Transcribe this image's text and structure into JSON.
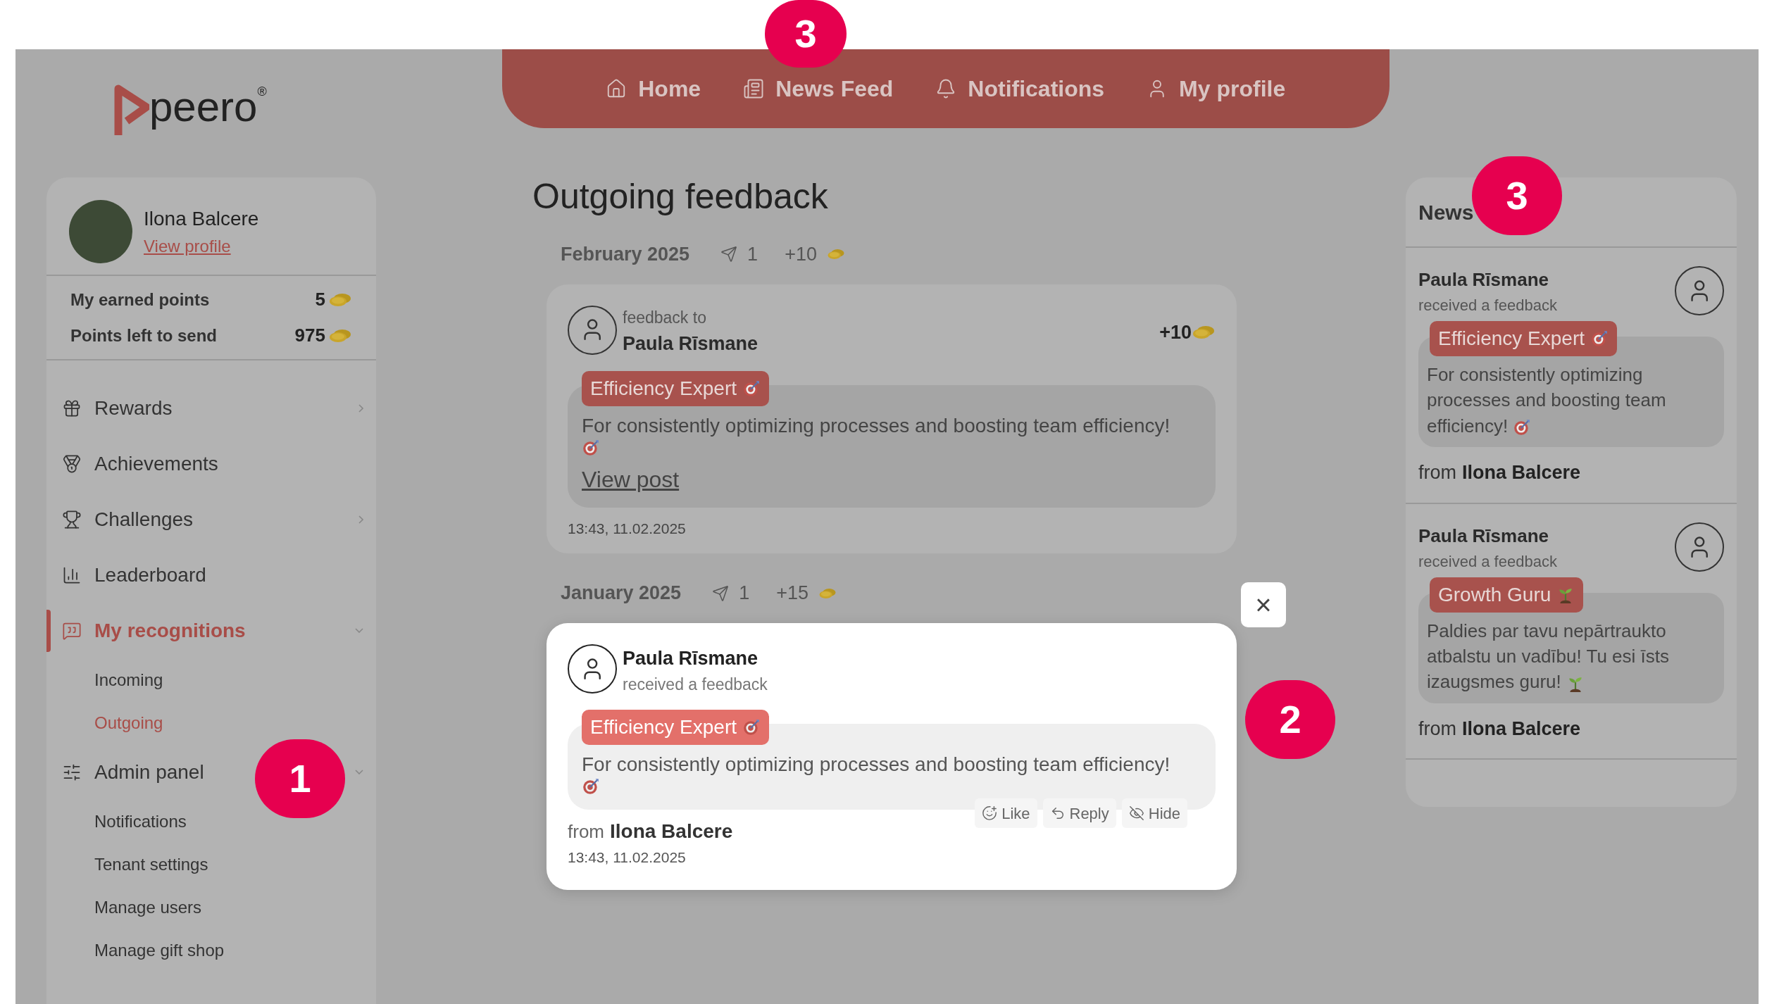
{
  "logo": {
    "text": "peero",
    "mark": "®"
  },
  "nav": [
    {
      "label": "Home",
      "selected": false
    },
    {
      "label": "News Feed",
      "selected": false
    },
    {
      "label": "Notifications",
      "selected": false
    },
    {
      "label": "My profile",
      "selected": false
    }
  ],
  "profile": {
    "name": "Ilona Balcere",
    "link": "View profile"
  },
  "points": [
    {
      "label": "My earned points",
      "value": "5"
    },
    {
      "label": "Points left to send",
      "value": "975"
    }
  ],
  "menu": [
    {
      "label": "Rewards",
      "kind": "group",
      "selected": false,
      "expanded": false
    },
    {
      "label": "Achievements",
      "kind": "link",
      "selected": false
    },
    {
      "label": "Challenges",
      "kind": "group",
      "selected": false,
      "expanded": false
    },
    {
      "label": "Leaderboard",
      "kind": "link",
      "selected": false
    },
    {
      "label": "My recognitions",
      "kind": "group",
      "selected": true,
      "expanded": true,
      "children": [
        {
          "label": "Incoming",
          "selected": false
        },
        {
          "label": "Outgoing",
          "selected": true
        }
      ]
    },
    {
      "label": "Admin panel",
      "kind": "group",
      "selected": false,
      "expanded": true,
      "children": [
        {
          "label": "Notifications",
          "selected": false
        },
        {
          "label": "Tenant settings",
          "selected": false
        },
        {
          "label": "Manage users",
          "selected": false
        },
        {
          "label": "Manage gift shop",
          "selected": false
        }
      ]
    }
  ],
  "page_title": "Outgoing feedback",
  "groups": [
    {
      "month": "February 2025",
      "sent": "1",
      "points": "+10",
      "card": {
        "highlighted": false,
        "kind": "outgoing",
        "caption": "feedback to",
        "person": "Paula Rīsmane",
        "points": "+10",
        "badge": {
          "label": "Efficiency Expert",
          "kind": "target"
        },
        "message": "For consistently optimizing processes and boosting team efficiency!",
        "link": "View post",
        "time": "13:43, 11.02.2025"
      }
    },
    {
      "month": "January 2025",
      "sent": "1",
      "points": "+15",
      "card": {
        "highlighted": true,
        "kind": "post",
        "person": "Paula Rīsmane",
        "caption": "received a feedback",
        "badge": {
          "label": "Efficiency Expert",
          "kind": "target"
        },
        "message": "For consistently optimizing processes and boosting team efficiency!",
        "actions": [
          "Like",
          "Reply",
          "Hide"
        ],
        "from_label": "from",
        "from": "Ilona Balcere",
        "time": "13:43, 11.02.2025"
      }
    }
  ],
  "close_button": "×",
  "news": {
    "title": "News",
    "items": [
      {
        "person": "Paula Rīsmane",
        "caption": "received a feedback",
        "badge": {
          "label": "Efficiency Expert",
          "kind": "target"
        },
        "message": "For consistently optimizing processes and boosting team efficiency!",
        "from_label": "from",
        "from": "Ilona Balcere"
      },
      {
        "person": "Paula Rīsmane",
        "caption": "received a feedback",
        "badge": {
          "label": "Growth Guru",
          "kind": "sprout"
        },
        "message": "Paldies par tavu nepārtraukto atbalstu un vadību! Tu esi īsts izaugsmes guru!",
        "from_label": "from",
        "from": "Ilona Balcere"
      }
    ]
  },
  "callouts": [
    {
      "label": "3",
      "kind": "nav"
    },
    {
      "label": "3",
      "kind": "news"
    },
    {
      "label": "1",
      "kind": "sidebar"
    },
    {
      "label": "2",
      "kind": "card"
    }
  ]
}
